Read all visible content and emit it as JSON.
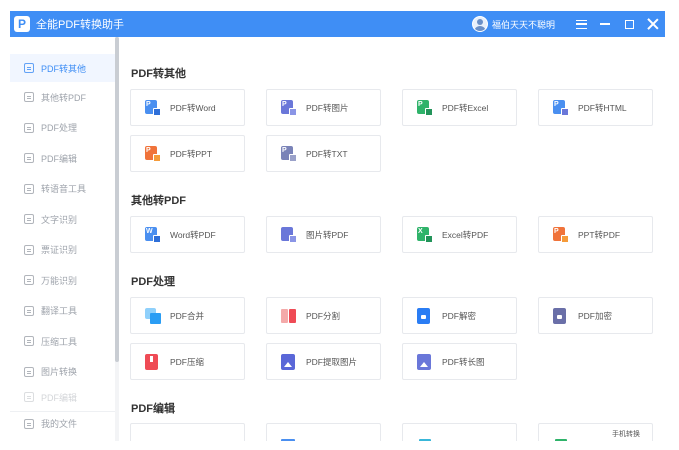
{
  "window": {
    "title": "全能PDF转换助手",
    "username": "福伯天天不聪明"
  },
  "sidebar": {
    "items": [
      {
        "label": "PDF转其他",
        "active": true
      },
      {
        "label": "其他转PDF"
      },
      {
        "label": "PDF处理"
      },
      {
        "label": "PDF编辑"
      },
      {
        "label": "转语音工具"
      },
      {
        "label": "文字识别"
      },
      {
        "label": "票证识别"
      },
      {
        "label": "万能识别"
      },
      {
        "label": "翻译工具"
      },
      {
        "label": "压缩工具"
      },
      {
        "label": "图片转换"
      },
      {
        "label": "PDF编辑"
      }
    ],
    "bottom": {
      "label": "我的文件"
    }
  },
  "sections": {
    "pdf_to_other": {
      "title": "PDF转其他",
      "cards": [
        {
          "label": "PDF转Word",
          "icon": "pdf-to-word-icon",
          "color": "#4a8ff0"
        },
        {
          "label": "PDF转图片",
          "icon": "pdf-to-image-icon",
          "color": "#6a77d9"
        },
        {
          "label": "PDF转Excel",
          "icon": "pdf-to-excel-icon",
          "color": "#2fb36a"
        },
        {
          "label": "PDF转HTML",
          "icon": "pdf-to-html-icon",
          "color": "#4a8ff0"
        },
        {
          "label": "PDF转PPT",
          "icon": "pdf-to-ppt-icon",
          "color": "#f0733a"
        },
        {
          "label": "PDF转TXT",
          "icon": "pdf-to-txt-icon",
          "color": "#7a83b8"
        }
      ]
    },
    "other_to_pdf": {
      "title": "其他转PDF",
      "cards": [
        {
          "label": "Word转PDF",
          "icon": "word-to-pdf-icon",
          "color": "#4a8ff0"
        },
        {
          "label": "图片转PDF",
          "icon": "image-to-pdf-icon",
          "color": "#6a77d9"
        },
        {
          "label": "Excel转PDF",
          "icon": "excel-to-pdf-icon",
          "color": "#2fb36a"
        },
        {
          "label": "PPT转PDF",
          "icon": "ppt-to-pdf-icon",
          "color": "#f0733a"
        }
      ]
    },
    "pdf_process": {
      "title": "PDF处理",
      "cards": [
        {
          "label": "PDF合并",
          "icon": "pdf-merge-icon",
          "color": "#2a9df4"
        },
        {
          "label": "PDF分割",
          "icon": "pdf-split-icon",
          "color": "#f07a7a"
        },
        {
          "label": "PDF解密",
          "icon": "pdf-decrypt-icon",
          "color": "#2a7df4"
        },
        {
          "label": "PDF加密",
          "icon": "pdf-encrypt-icon",
          "color": "#6a6fa8"
        },
        {
          "label": "PDF压缩",
          "icon": "pdf-compress-icon",
          "color": "#ef4b55"
        },
        {
          "label": "PDF提取图片",
          "icon": "pdf-extract-image-icon",
          "color": "#5a67d8"
        },
        {
          "label": "PDF转长图",
          "icon": "pdf-long-image-icon",
          "color": "#6a77d9"
        }
      ]
    },
    "pdf_edit": {
      "title": "PDF编辑",
      "partial_card_text": "手机转换"
    }
  }
}
